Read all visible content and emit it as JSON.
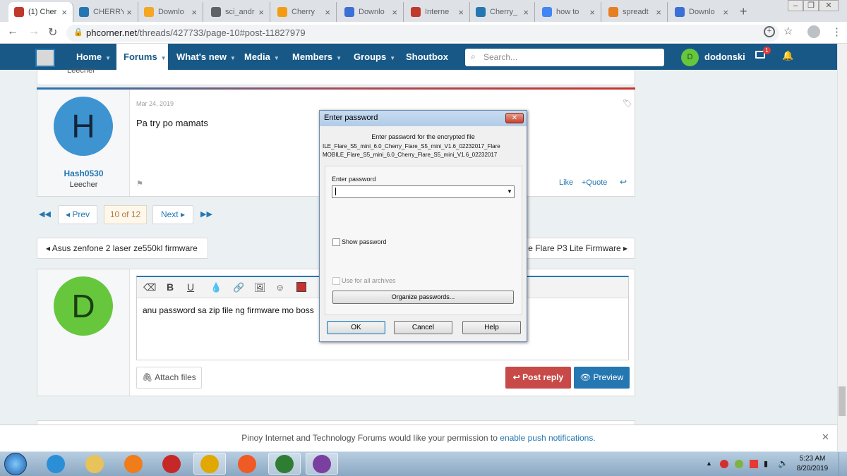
{
  "browser": {
    "tabs": [
      {
        "title": "(1) Cher",
        "icon": "phcorner-icon",
        "color": "#c0392b",
        "active": true
      },
      {
        "title": "CHERRY",
        "icon": "cherry-site-icon",
        "color": "#2577b1"
      },
      {
        "title": "Downlo",
        "icon": "download-site-icon",
        "color": "#f5a623"
      },
      {
        "title": "sci_andr",
        "icon": "globe-icon",
        "color": "#5f6368"
      },
      {
        "title": "Cherry",
        "icon": "cherry-f-icon",
        "color": "#f39c12"
      },
      {
        "title": "Downlo",
        "icon": "s-site-icon",
        "color": "#3b6fd8"
      },
      {
        "title": "Interne",
        "icon": "speedometer-icon",
        "color": "#c0392b"
      },
      {
        "title": "Cherry_",
        "icon": "cherry-site-icon",
        "color": "#2577b1"
      },
      {
        "title": "how to",
        "icon": "google-icon",
        "color": "#4285f4"
      },
      {
        "title": "spreadt",
        "icon": "spreadtrum-icon",
        "color": "#e67e22"
      },
      {
        "title": "Downlo",
        "icon": "download-arrow-icon",
        "color": "#3b6fd8"
      }
    ],
    "url_host": "phcorner.net",
    "url_path": "/threads/427733/page-10#post-11827979"
  },
  "site": {
    "nav": [
      "Home",
      "Forums",
      "What's new",
      "Media",
      "Members",
      "Groups",
      "Shoutbox"
    ],
    "active_nav": "Forums",
    "search_placeholder": "Search...",
    "username": "dodonski",
    "user_initial": "D",
    "inbox_count": "1",
    "prev_user_role": "Leecher"
  },
  "post": {
    "date": "Mar 24, 2019",
    "text": "Pa try po mamats",
    "author": "Hash0530",
    "avatar_initial": "H",
    "role": "Leecher",
    "like": "Like",
    "quote": "+Quote"
  },
  "pagination": {
    "prev": "Prev",
    "current": "10 of 12",
    "next": "Next"
  },
  "thread_nav": {
    "prev": "Asus zenfone 2 laser ze550kl firmware",
    "next": "e Flare P3 Lite Firmware"
  },
  "reply": {
    "avatar_initial": "D",
    "draft_text": "anu password sa zip file ng firmware mo boss",
    "attach": "Attach files",
    "post_reply": "Post reply",
    "preview": "Preview"
  },
  "notification_bar": {
    "text": "Pinoy Internet and Technology Forums would like your permission to",
    "link": "enable push notifications."
  },
  "dialog": {
    "title": "Enter password",
    "prompt": "Enter password for the encrypted file",
    "file_line1": "ILE_Flare_S5_mini_6.0_Cherry_Flare_S5_mini_V1.6_02232017_Flare",
    "file_line2": "MOBILE_Flare_S5_mini_6.0_Cherry_Flare_S5_mini_V1.6_02232017",
    "field_label": "Enter password",
    "password_value": "",
    "show_password": "Show password",
    "use_all": "Use for all archives",
    "organize": "Organize passwords...",
    "ok": "OK",
    "cancel": "Cancel",
    "help": "Help"
  },
  "taskbar": {
    "time": "5:23 AM",
    "date": "8/20/2019",
    "apps": [
      "start-orb-icon",
      "ie-icon",
      "explorer-icon",
      "media-player-icon",
      "garena-icon",
      "chrome-icon",
      "brave-icon",
      "idm-icon",
      "winrar-icon"
    ]
  },
  "colors": {
    "brand": "#185886",
    "accent": "#2577b1",
    "danger": "#c84a48",
    "avatar_h": "#3d94d1",
    "avatar_d": "#67c73c"
  }
}
